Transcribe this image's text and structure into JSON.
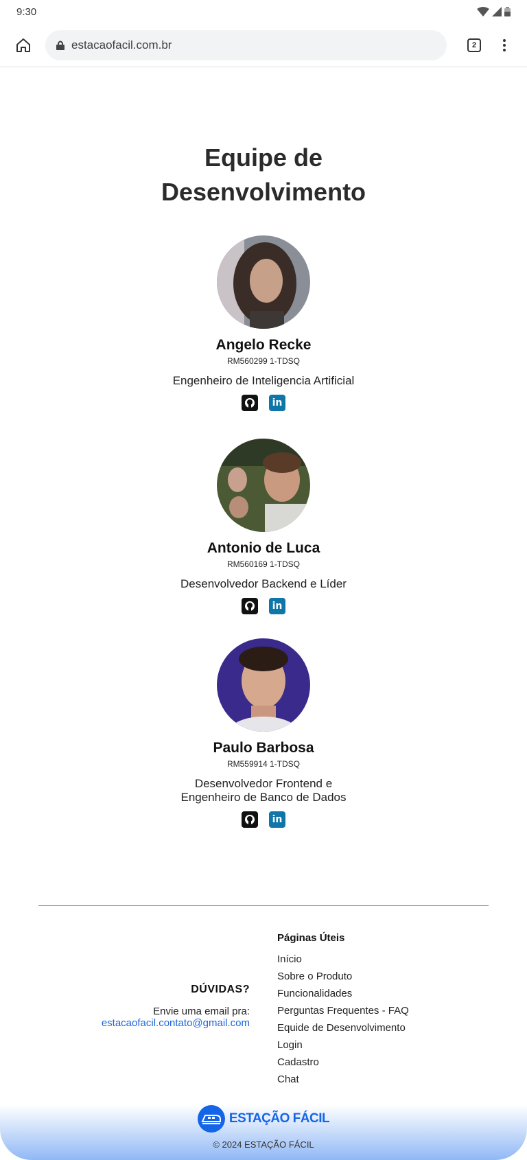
{
  "status_bar": {
    "time": "9:30"
  },
  "browser": {
    "url": "estacaofacil.com.br",
    "tab_count": "2"
  },
  "team": {
    "title_line1": "Equipe de",
    "title_line2": "Desenvolvimento",
    "members": [
      {
        "name": "Angelo Recke",
        "rm": "RM560299 1-TDSQ",
        "role": "Engenheiro de Inteligencia Artificial"
      },
      {
        "name": "Antonio de Luca",
        "rm": "RM560169 1-TDSQ",
        "role": "Desenvolvedor Backend e Líder"
      },
      {
        "name": "Paulo Barbosa",
        "rm": "RM559914 1-TDSQ",
        "role_line1": "Desenvolvedor Frontend e",
        "role_line2": "Engenheiro de Banco de Dados"
      }
    ]
  },
  "footer": {
    "contact_title": "DÚVIDAS?",
    "contact_text": "Envie uma email pra:",
    "contact_email": "estacaofacil.contato@gmail.com",
    "links_title": "Páginas Úteis",
    "links": [
      "Início",
      "Sobre o Produto",
      "Funcionalidades",
      "Perguntas Frequentes - FAQ",
      "Equide de Desenvolvimento",
      "Login",
      "Cadastro",
      "Chat"
    ],
    "brand_name": "ESTAÇÃO FÁCIL",
    "copyright": "© 2024 ESTAÇÃO FÁCIL"
  },
  "colors": {
    "accent": "#1565e8",
    "linkedin": "#0e76a8",
    "github": "#111111"
  }
}
